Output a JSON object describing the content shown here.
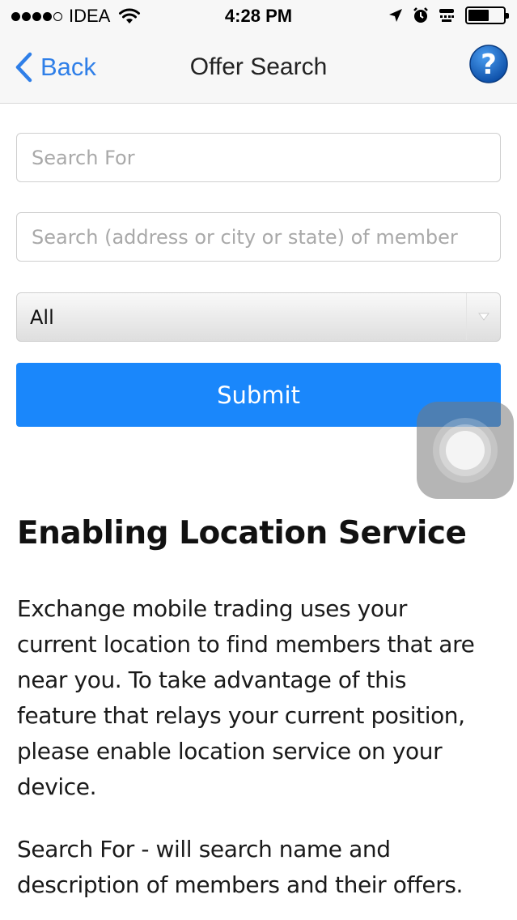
{
  "status_bar": {
    "carrier": "IDEA",
    "time": "4:28 PM",
    "battery_level": 0.6,
    "icons": [
      "signal-dots-icon",
      "wifi-icon",
      "location-arrow-icon",
      "alarm-icon",
      "tty-icon",
      "battery-icon"
    ]
  },
  "nav": {
    "back_label": "Back",
    "title": "Offer Search",
    "help_glyph": "?"
  },
  "form": {
    "search_for_placeholder": "Search For",
    "location_placeholder": "Search (address or city or state) of member",
    "category_selected": "All",
    "submit_label": "Submit"
  },
  "info": {
    "heading": "Enabling Location Service",
    "paragraph1": "Exchange mobile trading uses your\ncurrent location to find members that are\nnear you. To take  advantage of this\nfeature that relays your current position,\nplease enable location service on your\ndevice.",
    "paragraph2": "Search For - will search name and\ndescription of members and their offers."
  },
  "colors": {
    "accent_blue": "#1a87fb",
    "link_blue": "#2f7fe8",
    "help_blue": "#1565c0"
  }
}
